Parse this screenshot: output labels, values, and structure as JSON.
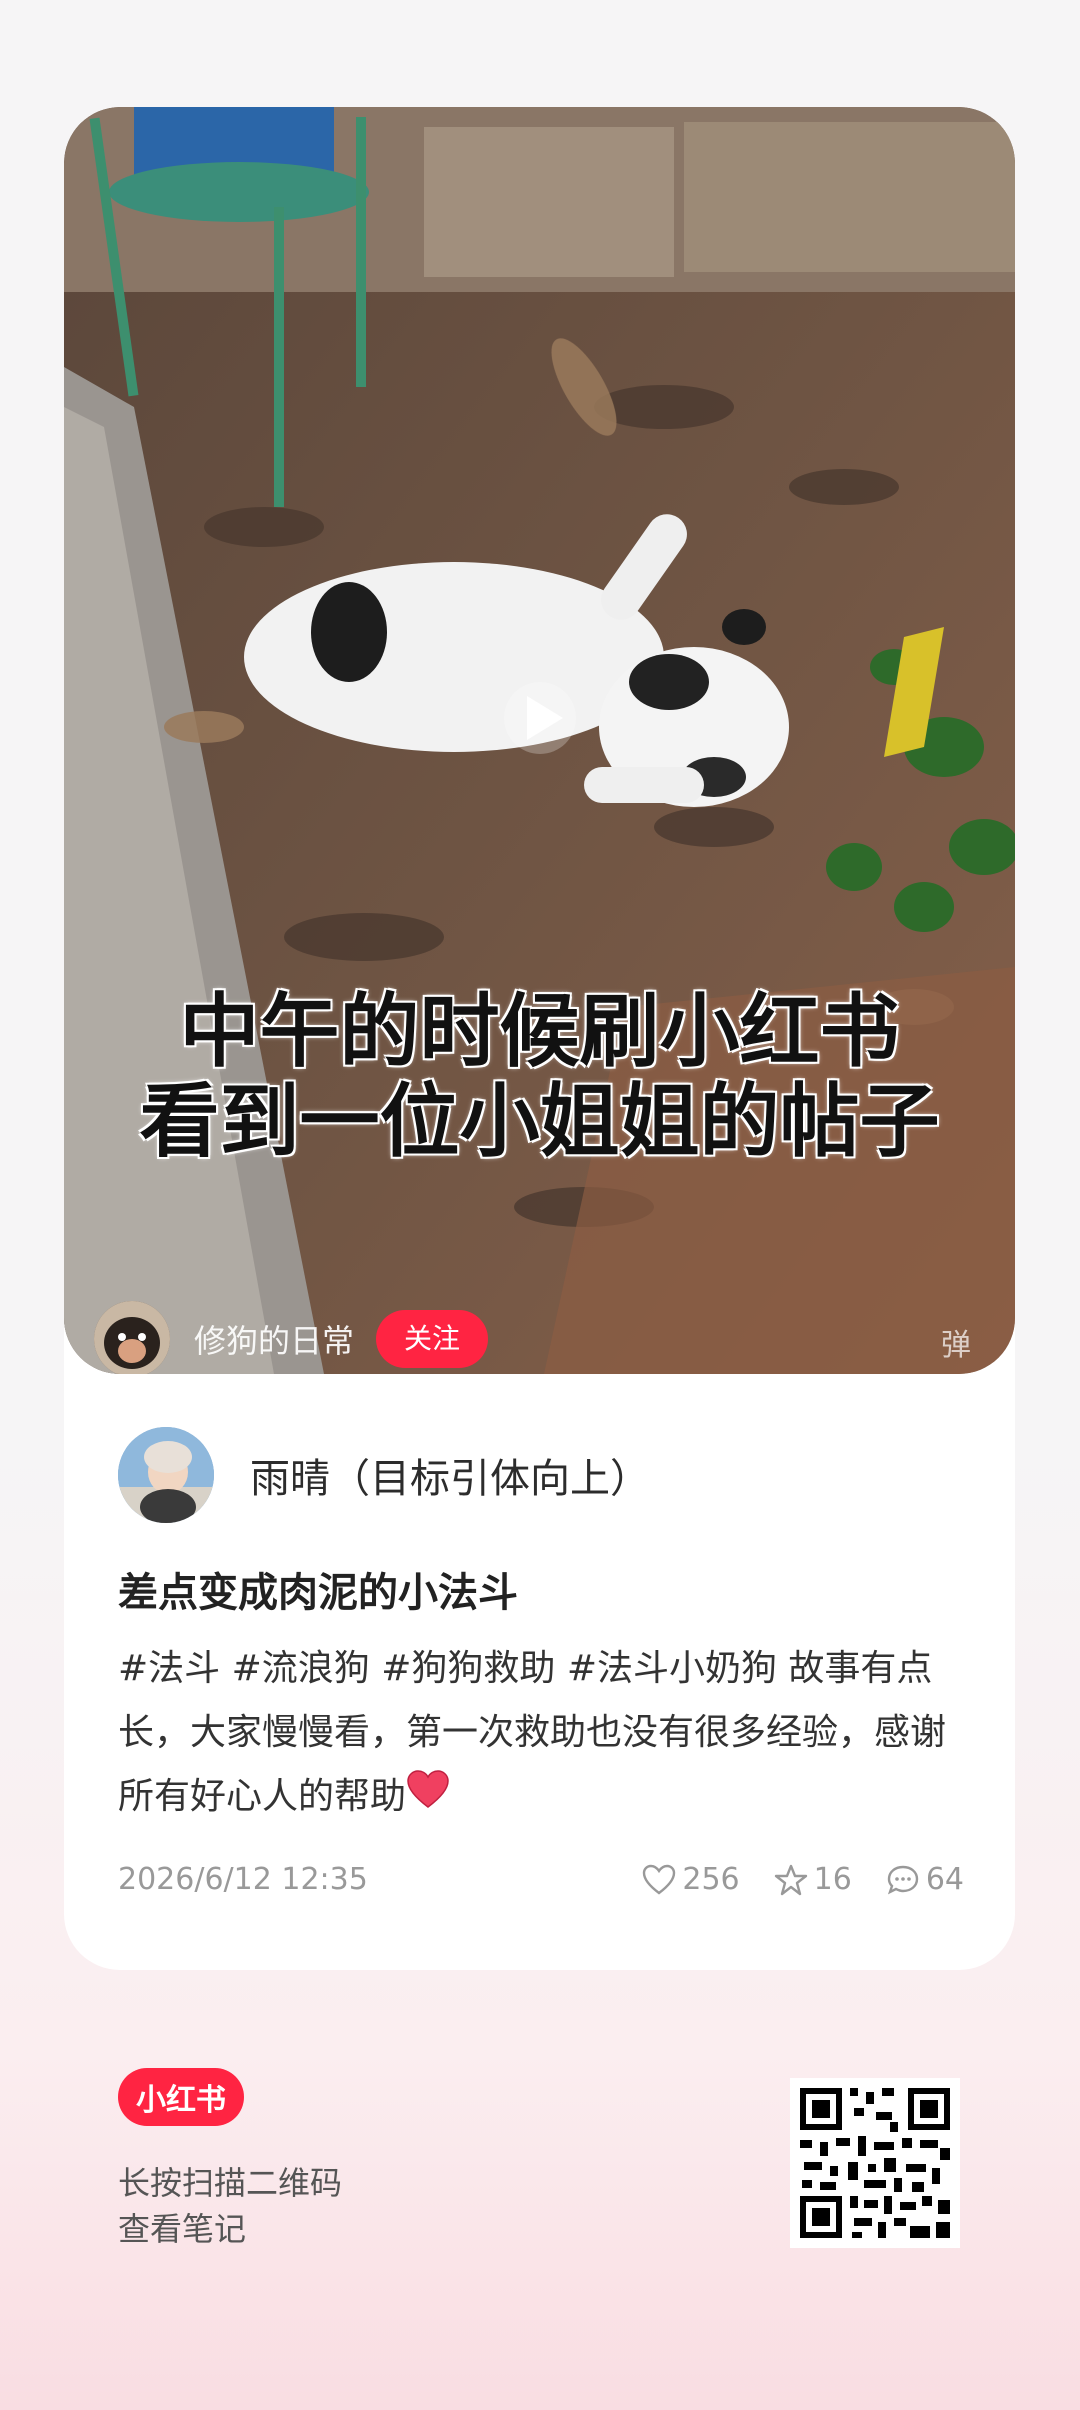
{
  "media": {
    "caption_line1": "中午的时候刷小红书",
    "caption_line2": "看到一位小姐姐的帖子",
    "mini_user_name": "修狗的日常",
    "follow_label": "关注",
    "danmu_label": "弹"
  },
  "post": {
    "author_name": "雨晴（目标引体向上）",
    "title": "差点变成肉泥的小法斗",
    "description": "#法斗  #流浪狗  #狗狗救助  #法斗小奶狗  故事有点长，大家慢慢看，第一次救助也没有很多经验，感谢所有好心人的帮助",
    "date": "2026/6/12 12:35",
    "likes": "256",
    "stars": "16",
    "comments": "64"
  },
  "footer": {
    "logo_text": "小红书",
    "line1": "长按扫描二维码",
    "line2": "查看笔记"
  },
  "colors": {
    "accent": "#ff2442"
  }
}
